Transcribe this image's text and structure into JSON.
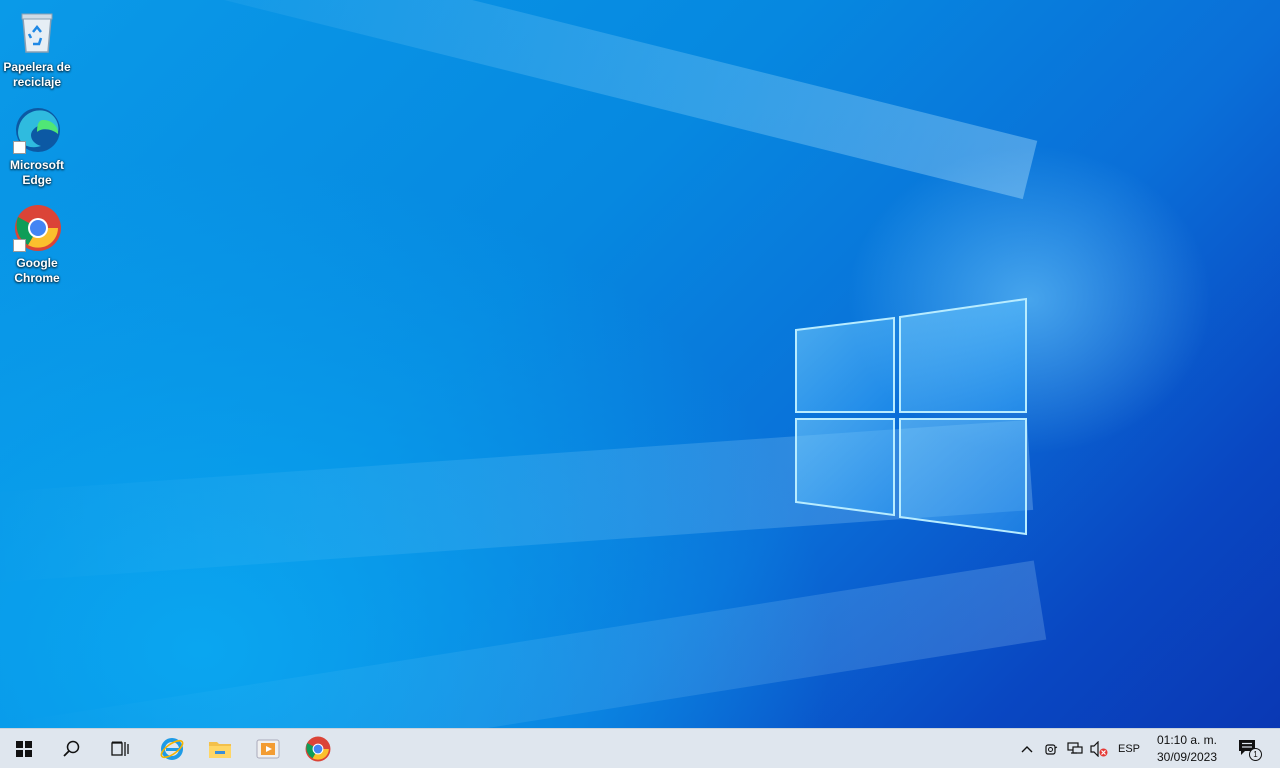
{
  "desktop": {
    "icons": [
      {
        "label": "Papelera de\nreciclaje",
        "icon": "recycle-bin-icon"
      },
      {
        "label": "Microsoft\nEdge",
        "icon": "edge-icon"
      },
      {
        "label": "Google\nChrome",
        "icon": "chrome-icon"
      }
    ]
  },
  "taskbar": {
    "start_icon": "windows-logo-icon",
    "search_icon": "search-icon",
    "taskview_icon": "task-view-icon",
    "pinned": [
      {
        "icon": "internet-explorer-icon"
      },
      {
        "icon": "file-explorer-icon"
      },
      {
        "icon": "media-player-icon"
      },
      {
        "icon": "chrome-icon"
      }
    ],
    "tray": {
      "language": "ESP",
      "time": "01:10 a. m.",
      "date": "30/09/2023",
      "notification_count": "1"
    }
  },
  "colors": {
    "accent": "#0078d7",
    "taskbar_bg": "#dfe6ee"
  }
}
